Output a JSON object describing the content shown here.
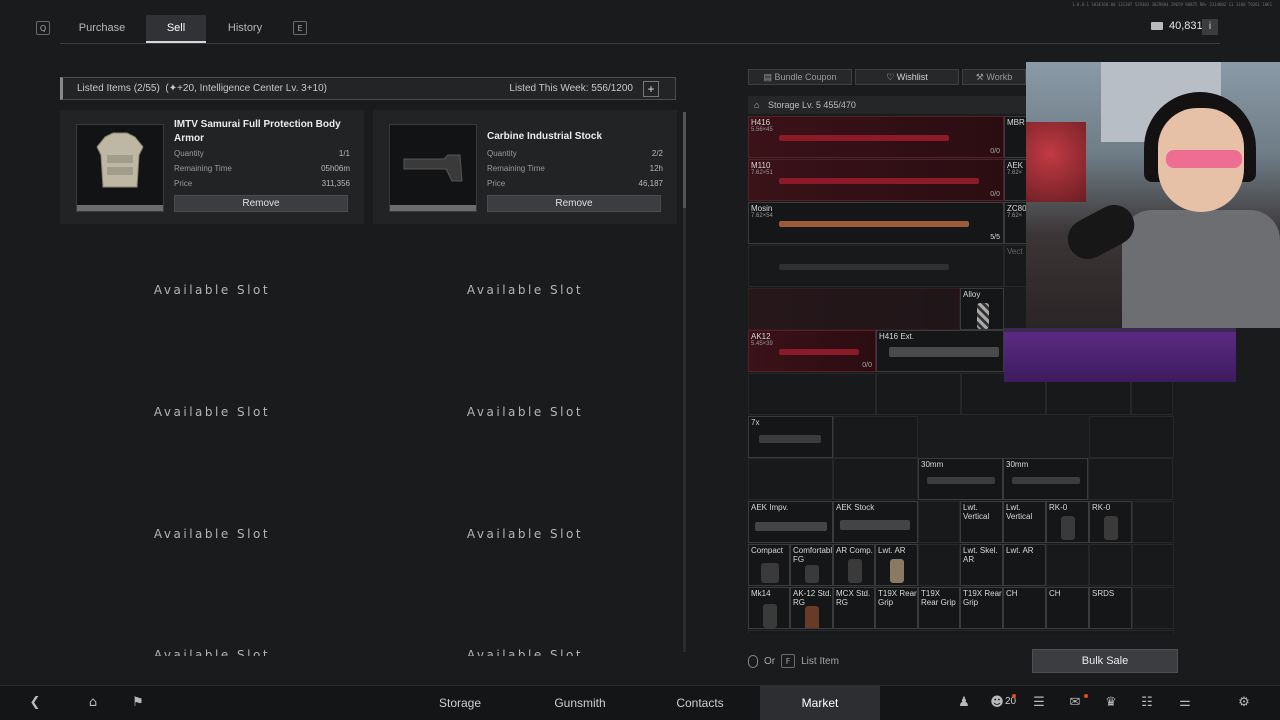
{
  "topbar": {
    "key_left": "Q",
    "key_right": "E",
    "tabs": [
      {
        "label": "Purchase",
        "active": false
      },
      {
        "label": "Sell",
        "active": true
      },
      {
        "label": "History",
        "active": false
      }
    ],
    "currency": "40,831K",
    "info_label": "i"
  },
  "listing": {
    "listed_items": "Listed Items (2/55)",
    "bonus": "(✦+20, Intelligence Center Lv. 3+10)",
    "listed_week": "Listed This Week: 556/1200",
    "add_label": "+"
  },
  "items": [
    {
      "name": "IMTV Samurai Full Protection Body Armor",
      "quantity_label": "Quantity",
      "quantity": "1/1",
      "time_label": "Remaining Time",
      "time": "05h06m",
      "price_label": "Price",
      "price": "311,356",
      "remove_label": "Remove"
    },
    {
      "name": "Carbine Industrial Stock",
      "quantity_label": "Quantity",
      "quantity": "2/2",
      "time_label": "Remaining Time",
      "time": "12h",
      "price_label": "Price",
      "price": "46,187",
      "remove_label": "Remove"
    }
  ],
  "slots": {
    "available_label": "Available Slot"
  },
  "storage": {
    "bundle_coupon": "Bundle Coupon",
    "wishlist": "Wishlist",
    "workbench": "Workb",
    "header": "Storage Lv. 5  455/470"
  },
  "grid_cells": {
    "h416": "H416",
    "h416_cal": "5.56×45",
    "h416_cnt": "0/0",
    "m110": "M110",
    "m110_cal": "7.62×51",
    "m110_cnt": "0/0",
    "mosin": "Mosin",
    "mosin_cal": "7.62×54",
    "mosin_cnt": "5/5",
    "ak12": "AK12",
    "ak12_cal": "5.45×39",
    "ak12_cnt": "0/0",
    "alloy": "Alloy",
    "h416_ext": "H416 Ext.",
    "x7": "7x",
    "m30a": "30mm",
    "m30b": "30mm",
    "aek_impv": "AEK Impv.",
    "aek_stock": "AEK Stock",
    "lwt_vert1": "Lwt. Vertical",
    "lwt_vert2": "Lwt. Vertical",
    "rk0a": "RK-0",
    "rk0b": "RK-0",
    "compact": "Compact",
    "comfortable": "Comfortable FG",
    "ar_comp": "AR Comp.",
    "lwt_ar": "Lwt. AR",
    "lwt_skel": "Lwt. Skel. AR",
    "lwt_ar2": "Lwt. AR",
    "mk14": "Mk14",
    "ak12_std": "AK-12 Std. RG",
    "mcx_std": "MCX Std. RG",
    "t19x_a": "T19X Rear Grip",
    "t19x_b": "T19X Rear Grip",
    "t19x_c": "T19X Rear Grip",
    "ch1": "CH",
    "ch2": "CH",
    "srds": "SRDS",
    "mbr": "MBR",
    "aek": "AEK",
    "aek_cal": "7.62×",
    "zc": "ZC80",
    "zc_cal": "7.62×",
    "vect": "Vect"
  },
  "footer": {
    "or_label": "Or",
    "key_f": "F",
    "list_item": "List Item",
    "bulk_sale": "Bulk Sale"
  },
  "bottomnav": {
    "items": [
      {
        "label": "Storage",
        "active": false
      },
      {
        "label": "Gunsmith",
        "active": false
      },
      {
        "label": "Contacts",
        "active": false
      },
      {
        "label": "Market",
        "active": true
      }
    ],
    "friends_count": "20"
  },
  "colors": {
    "accent_red": "#8c1a28",
    "panel": "#212325",
    "background": "#1a1b1d",
    "stream_purple": "#5a2a82"
  },
  "version_text": "1.0.0.1 103E160.08 131387 529303 3829884 29659 80875 RB+ 2314802 11 3100 T9261 1061"
}
